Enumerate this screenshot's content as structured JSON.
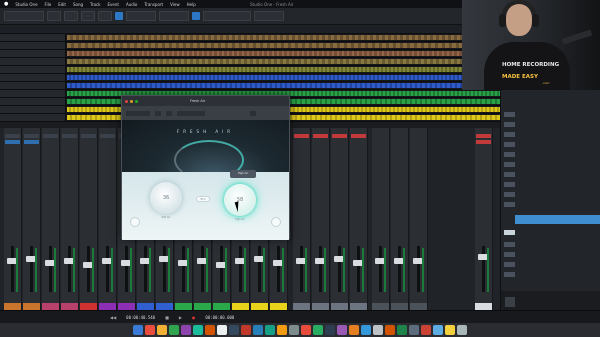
{
  "menubar": {
    "items": [
      "Studio One",
      "File",
      "Edit",
      "Song",
      "Track",
      "Event",
      "Audio",
      "Transport",
      "View",
      "Help"
    ],
    "window_title": "Studio One - Fresh Air"
  },
  "plugin": {
    "window_title": "Fresh Air",
    "name": "FRESH AIR",
    "knob_left_value": "36",
    "knob_left_label": "Mid Air",
    "knob_right_value": "58",
    "knob_right_label": "High Air",
    "center_button": "Trim",
    "tooltip": "High Air"
  },
  "transport": {
    "timecode_1": "00:00:40.540",
    "timecode_2": "00:00:00.000"
  },
  "webcam": {
    "shirt_line_1": "HOME RECORDING",
    "shirt_line_2": "MADE EASY",
    "shirt_line_3": ".com"
  },
  "colors": {
    "accent": "#2d78c4",
    "track_green": "#2aa84a",
    "track_blue": "#2f5fd1",
    "track_yellow": "#e8d21a",
    "track_olive": "#8a8f3a",
    "plugin_glow": "#4fe3c9"
  }
}
